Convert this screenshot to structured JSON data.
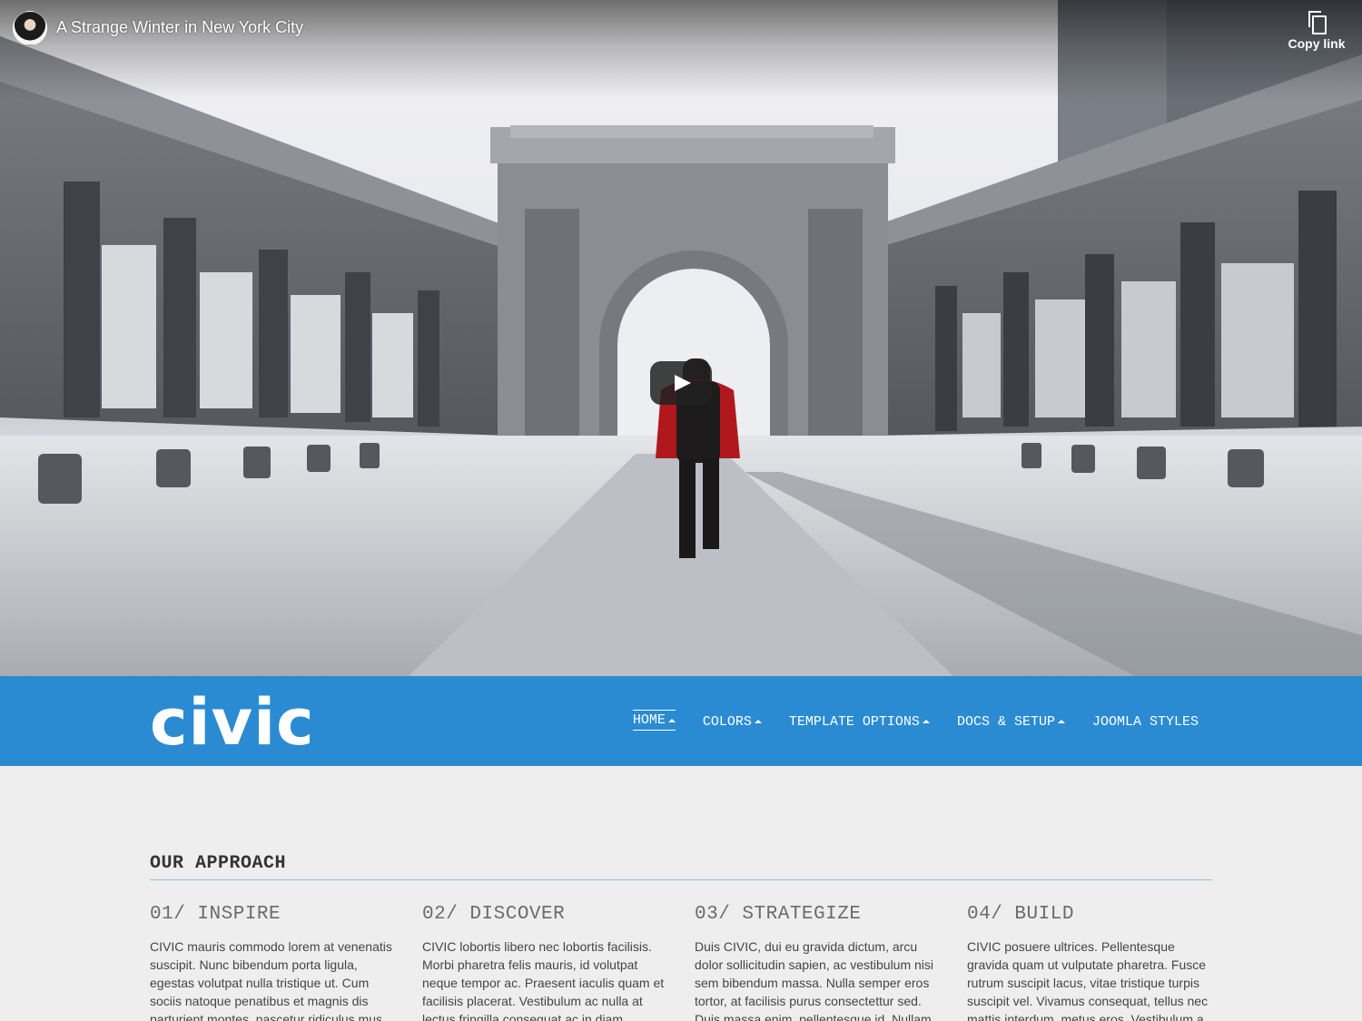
{
  "video": {
    "title": "A Strange Winter in New York City",
    "copy_link_label": "Copy link"
  },
  "nav": {
    "logo": "civic",
    "items": [
      {
        "label": "HOME",
        "has_caret": true,
        "active": true
      },
      {
        "label": "COLORS",
        "has_caret": true
      },
      {
        "label": "TEMPLATE OPTIONS",
        "has_caret": true
      },
      {
        "label": "DOCS & SETUP",
        "has_caret": true
      },
      {
        "label": "JOOMLA STYLES",
        "has_caret": false
      }
    ]
  },
  "approach": {
    "title": "OUR APPROACH",
    "columns": [
      {
        "heading": "01/ INSPIRE",
        "text": "CIVIC mauris commodo lorem at venenatis suscipit. Nunc bibendum porta ligula, egestas volutpat nulla tristique ut. Cum sociis natoque penatibus et magnis dis parturient montes, nascetur ridiculus mus."
      },
      {
        "heading": "02/ DISCOVER",
        "text": "CIVIC lobortis libero nec lobortis facilisis. Morbi pharetra felis mauris, id volutpat neque tempor ac. Praesent iaculis quam et facilisis placerat. Vestibulum ac nulla at lectus fringilla consequat ac in diam."
      },
      {
        "heading": "03/ STRATEGIZE",
        "text": "Duis CIVIC, dui eu gravida dictum, arcu dolor sollicitudin sapien, ac vestibulum nisi sem bibendum massa. Nulla semper eros tortor, at facilisis purus consectettur sed. Duis massa enim, pellentesque id. Nullam."
      },
      {
        "heading": "04/ BUILD",
        "text": "CIVIC posuere ultrices. Pellentesque gravida quam ut vulputate pharetra. Fusce rutrum suscipit lacus, vitae tristique turpis suscipit vel. Vivamus consequat, tellus nec mattis interdum, metus eros. Vestibulum a."
      }
    ]
  }
}
